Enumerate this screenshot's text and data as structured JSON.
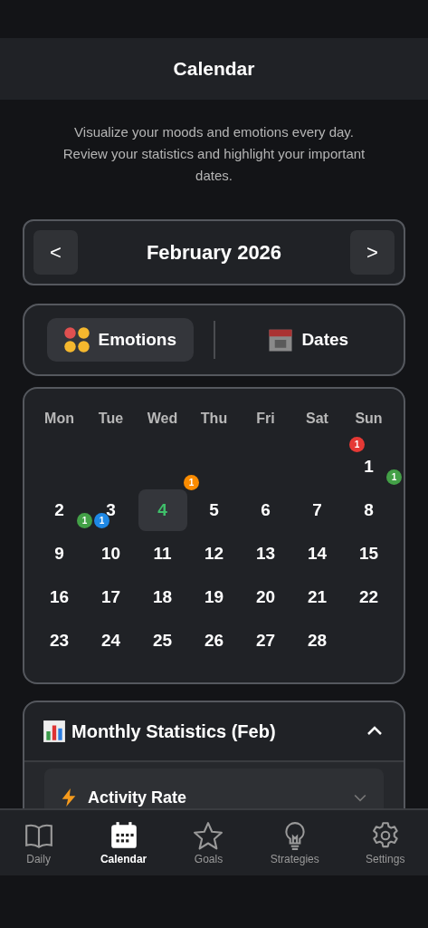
{
  "header": {
    "title": "Calendar"
  },
  "intro": "Visualize your moods and emotions every day. Review your statistics and highlight your important dates.",
  "month_nav": {
    "prev": "<",
    "label": "February 2026",
    "next": ">"
  },
  "modes": [
    {
      "label": "Emotions",
      "kind": "emotions",
      "selected": true
    },
    {
      "label": "Dates",
      "kind": "dates",
      "selected": false
    }
  ],
  "calendar": {
    "weekdays": [
      "Mon",
      "Tue",
      "Wed",
      "Thu",
      "Fri",
      "Sat",
      "Sun"
    ],
    "weeks": [
      {
        "align_end": true,
        "days": [
          {
            "day": "1",
            "selected": false,
            "badges": [
              {
                "count": "1",
                "color": "#e53935",
                "top": true,
                "right": false
              },
              {
                "count": "1",
                "color": "#43a047",
                "top": false,
                "right": true
              }
            ]
          }
        ]
      },
      {
        "align_end": false,
        "days": [
          {
            "day": "2",
            "selected": false,
            "badges": [
              {
                "count": "1",
                "color": "#43a047",
                "right": true
              }
            ]
          },
          {
            "day": "3",
            "selected": false,
            "badges": [
              {
                "count": "1",
                "color": "#1e88e5",
                "top": false,
                "right": false
              }
            ]
          },
          {
            "day": "4",
            "selected": true,
            "badges": [
              {
                "count": "1",
                "color": "#fb8c00",
                "top": true,
                "right": true
              }
            ]
          },
          {
            "day": "5",
            "selected": false
          },
          {
            "day": "6",
            "selected": false
          },
          {
            "day": "7",
            "selected": false
          },
          {
            "day": "8",
            "selected": false
          }
        ]
      },
      {
        "days": [
          {
            "day": "9",
            "selected": false
          },
          {
            "day": "10",
            "selected": false
          },
          {
            "day": "11",
            "selected": false
          },
          {
            "day": "12",
            "selected": false
          },
          {
            "day": "13",
            "selected": false
          },
          {
            "day": "14",
            "selected": false
          },
          {
            "day": "15",
            "selected": false
          }
        ]
      },
      {
        "days": [
          {
            "day": "16",
            "selected": false
          },
          {
            "day": "17",
            "selected": false
          },
          {
            "day": "18",
            "selected": false
          },
          {
            "day": "19",
            "selected": false
          },
          {
            "day": "20",
            "selected": false
          },
          {
            "day": "21",
            "selected": false
          },
          {
            "day": "22",
            "selected": false
          }
        ]
      },
      {
        "days": [
          {
            "day": "23",
            "selected": false
          },
          {
            "day": "24",
            "selected": false
          },
          {
            "day": "25",
            "selected": false
          },
          {
            "day": "26",
            "selected": false
          },
          {
            "day": "27",
            "selected": false
          },
          {
            "day": "28",
            "selected": false
          }
        ]
      }
    ]
  },
  "stats": {
    "title": "Monthly Statistics (Feb)",
    "expanded": true,
    "items": [
      {
        "label": "Activity Rate",
        "expanded": false
      }
    ]
  },
  "nav": [
    {
      "label": "Daily",
      "kind": "book",
      "selected": false
    },
    {
      "label": "Calendar",
      "kind": "calendar",
      "selected": true
    },
    {
      "label": "Goals",
      "kind": "star",
      "selected": false
    },
    {
      "label": "Strategies",
      "kind": "bulb",
      "selected": false
    },
    {
      "label": "Settings",
      "kind": "gear",
      "selected": false
    }
  ]
}
